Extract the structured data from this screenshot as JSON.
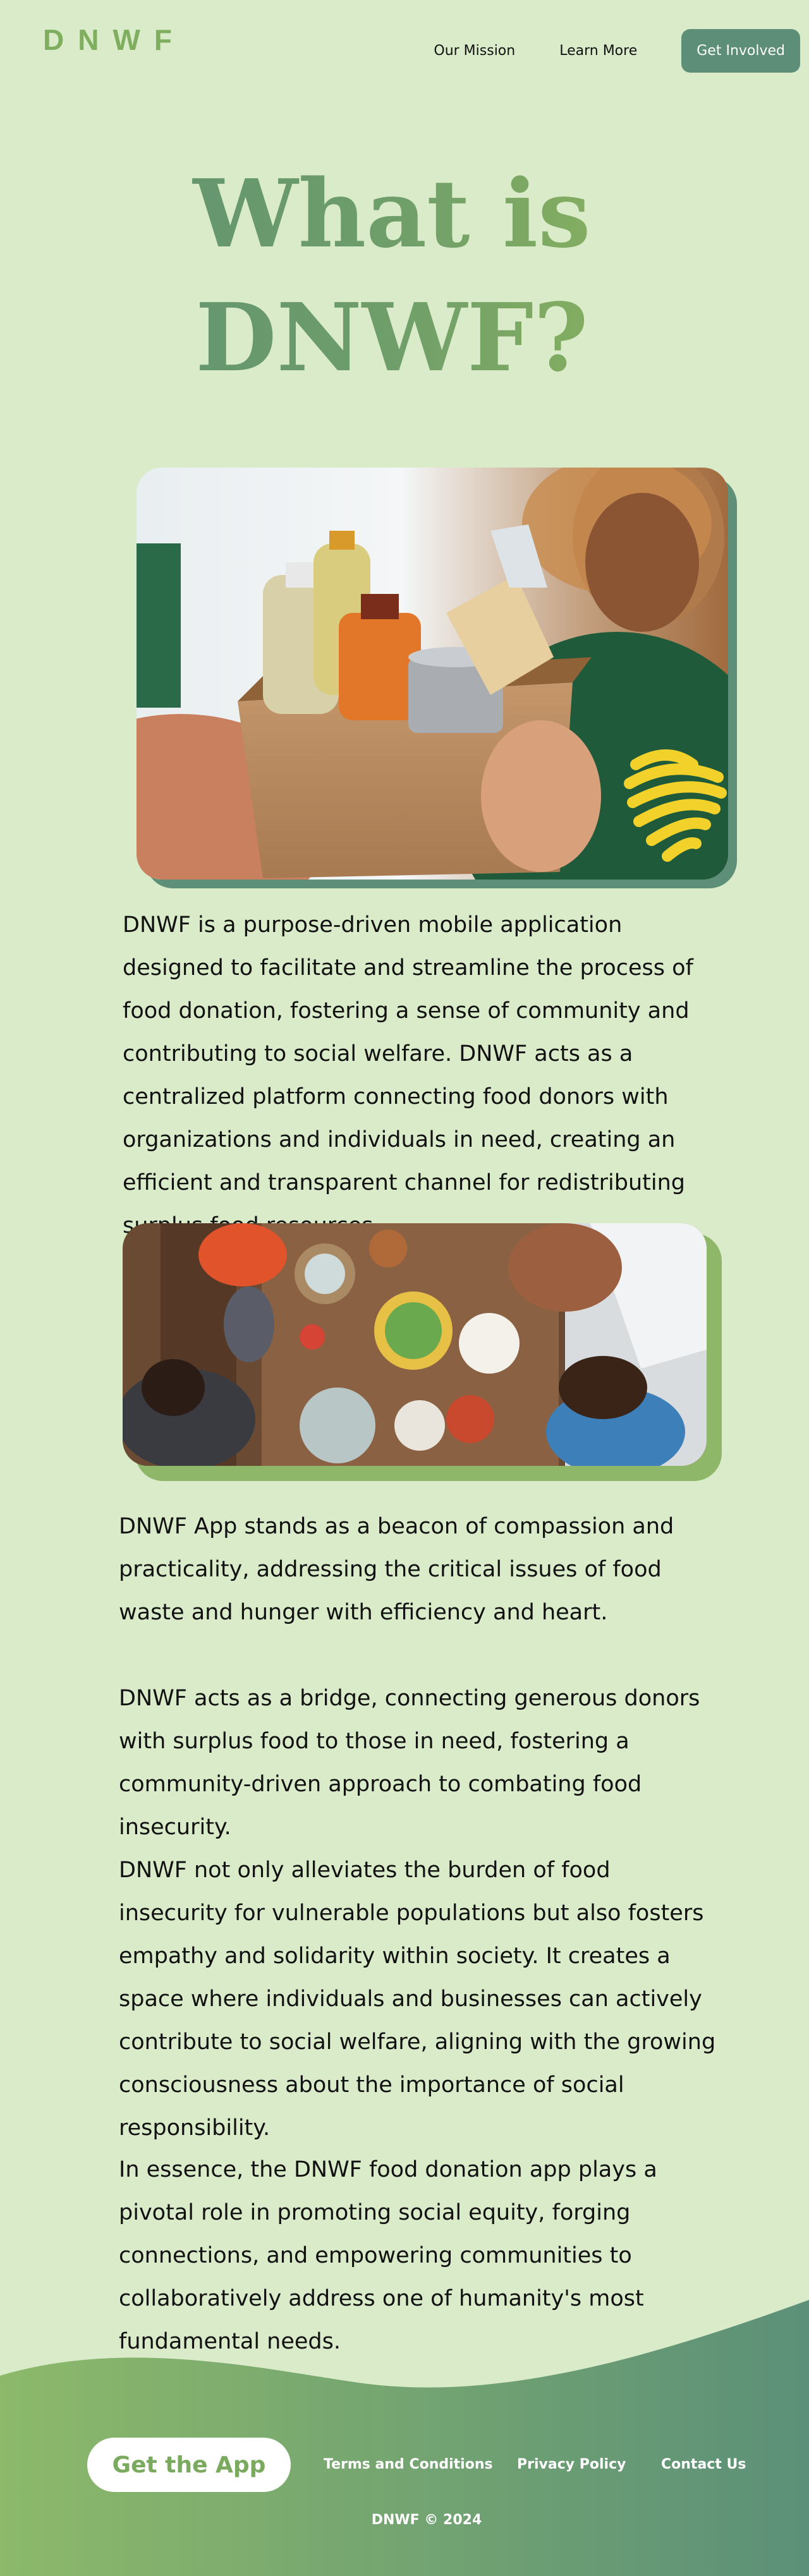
{
  "header": {
    "logo_text": "DNWF",
    "nav": {
      "mission": "Our Mission",
      "learn": "Learn More",
      "get_involved": "Get Involved"
    }
  },
  "hero": {
    "title_line1": "What is",
    "title_line2": "DNWF?"
  },
  "paragraphs": {
    "p1": "DNWF is a purpose-driven mobile application designed to facilitate and streamline the process of food donation, fostering a sense of community and contributing to social welfare. DNWF acts as a centralized platform connecting food donors with organizations and individuals in need, creating an efficient and transparent channel for redistributing surplus food resources.",
    "p2": "DNWF App stands as a beacon of compassion and practicality, addressing the critical issues of food waste and hunger with efficiency and heart.",
    "p3": "DNWF acts as a bridge, connecting generous donors with surplus food to those in need, fostering a community-driven approach to combating food insecurity.",
    "p4": "DNWF not only alleviates the burden of food insecurity for vulnerable populations but also fosters empathy and solidarity within society. It creates a space where individuals and businesses can actively contribute to social welfare, aligning with the growing consciousness about the importance of social responsibility.",
    "p5": "In essence, the DNWF food donation app plays a pivotal role in promoting social equity, forging connections, and empowering communities to collaboratively address one of humanity's most fundamental needs."
  },
  "footer": {
    "app_button": "Get the App",
    "terms": "Terms and Conditions",
    "privacy": "Privacy Policy",
    "contact": "Contact Us",
    "copyright": "DNWF © 2024"
  },
  "colors": {
    "background": "#daebc9",
    "accent_dark": "#5d8f78",
    "accent_light": "#7fae5f",
    "heart_yellow": "#f2d22a"
  }
}
